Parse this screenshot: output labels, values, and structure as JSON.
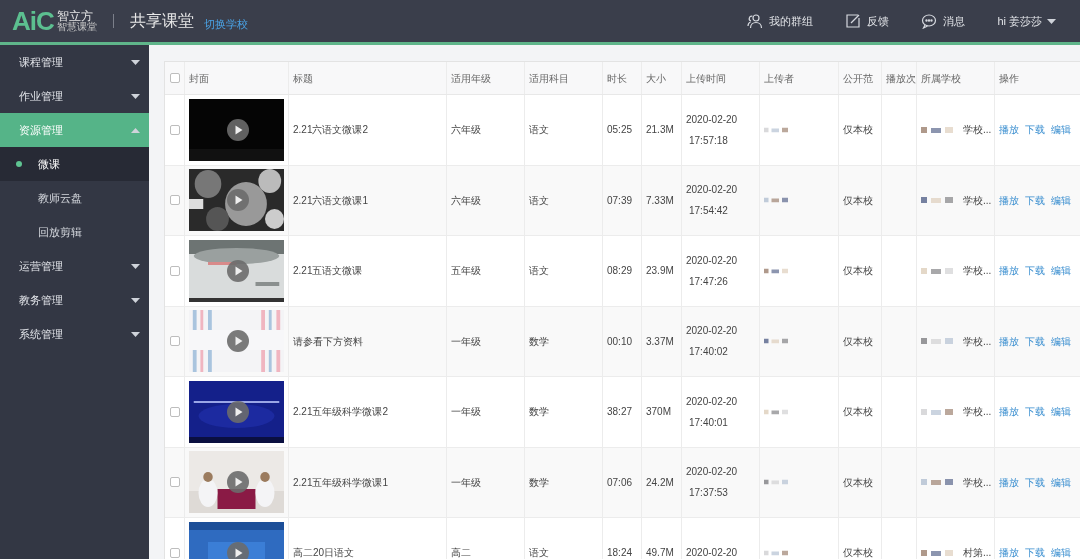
{
  "header": {
    "logo": {
      "mark": "AiC",
      "name": "智立方",
      "tagline": "智慧课堂"
    },
    "title": "共享课堂",
    "switch_link": "切换学校",
    "nav": [
      {
        "kind": "group",
        "label": "我的群组"
      },
      {
        "kind": "feedback",
        "label": "反馈"
      },
      {
        "kind": "message",
        "label": "消息"
      }
    ],
    "user": "hi 姜莎莎"
  },
  "sidebar": {
    "items": [
      {
        "label": "课程管理",
        "expanded": false,
        "selected": false
      },
      {
        "label": "作业管理",
        "expanded": false,
        "selected": false
      },
      {
        "label": "资源管理",
        "expanded": true,
        "selected": true,
        "children": [
          {
            "label": "微课",
            "selected": true
          },
          {
            "label": "教师云盘",
            "selected": false
          },
          {
            "label": "回放剪辑",
            "selected": false
          }
        ]
      },
      {
        "label": "运营管理",
        "expanded": false,
        "selected": false
      },
      {
        "label": "教务管理",
        "expanded": false,
        "selected": false
      },
      {
        "label": "系统管理",
        "expanded": false,
        "selected": false
      }
    ]
  },
  "table": {
    "select_all": {
      "checked": false
    },
    "columns": [
      "封面",
      "标题",
      "适用年级",
      "适用科目",
      "时长",
      "大小",
      "上传时间",
      "上传者",
      "公开范",
      "播放次",
      "所属学校",
      "操作"
    ],
    "rows": [
      {
        "checked": false,
        "title": "2.21六语文微课2",
        "grade": "六年级",
        "subject": "语文",
        "duration": "05:25",
        "size": "21.3M",
        "date": "2020-02-20",
        "time": "17:57:18",
        "scope": "仅本校",
        "school": "学校...",
        "actions": [
          "播放",
          "下载",
          "编辑"
        ]
      },
      {
        "checked": false,
        "title": "2.21六语文微课1",
        "grade": "六年级",
        "subject": "语文",
        "duration": "07:39",
        "size": "7.33M",
        "date": "2020-02-20",
        "time": "17:54:42",
        "scope": "仅本校",
        "school": "学校...",
        "actions": [
          "播放",
          "下载",
          "编辑"
        ]
      },
      {
        "checked": false,
        "title": "2.21五语文微课",
        "grade": "五年级",
        "subject": "语文",
        "duration": "08:29",
        "size": "23.9M",
        "date": "2020-02-20",
        "time": "17:47:26",
        "scope": "仅本校",
        "school": "学校...",
        "actions": [
          "播放",
          "下载",
          "编辑"
        ]
      },
      {
        "checked": false,
        "title": "请参看下方资料",
        "grade": "一年级",
        "subject": "数学",
        "duration": "00:10",
        "size": "3.37M",
        "date": "2020-02-20",
        "time": "17:40:02",
        "scope": "仅本校",
        "school": "学校...",
        "actions": [
          "播放",
          "下载",
          "编辑"
        ]
      },
      {
        "checked": false,
        "title": "2.21五年级科学微课2",
        "grade": "一年级",
        "subject": "数学",
        "duration": "38:27",
        "size": "370M",
        "date": "2020-02-20",
        "time": "17:40:01",
        "scope": "仅本校",
        "school": "学校...",
        "actions": [
          "播放",
          "下载",
          "编辑"
        ]
      },
      {
        "checked": false,
        "title": "2.21五年级科学微课1",
        "grade": "一年级",
        "subject": "数学",
        "duration": "07:06",
        "size": "24.2M",
        "date": "2020-02-20",
        "time": "17:37:53",
        "scope": "仅本校",
        "school": "学校...",
        "actions": [
          "播放",
          "下载",
          "编辑"
        ]
      },
      {
        "checked": false,
        "title": "高二20日语文",
        "grade": "高二",
        "subject": "语文",
        "duration": "18:24",
        "size": "49.7M",
        "date": "2020-02-20",
        "scope": "仅本校",
        "school": "村第...",
        "actions": [
          "播放",
          "下载",
          "编辑"
        ]
      }
    ]
  }
}
